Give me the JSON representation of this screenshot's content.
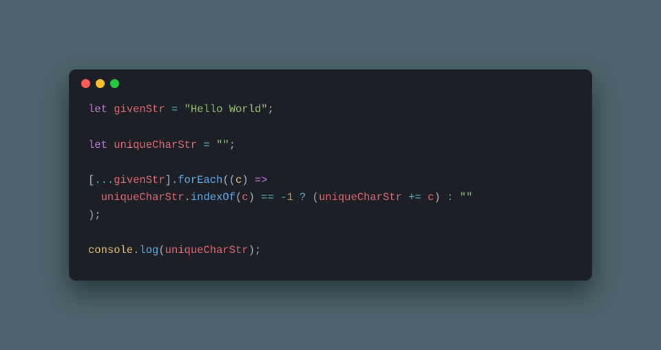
{
  "window": {
    "traffic": {
      "close": "close",
      "minimize": "minimize",
      "zoom": "zoom"
    }
  },
  "code": {
    "line1": {
      "kw": "let",
      "var": "givenStr",
      "assign": "=",
      "str": "\"Hello World\"",
      "semi": ";"
    },
    "line3": {
      "kw": "let",
      "var": "uniqueCharStr",
      "assign": "=",
      "str": "\"\"",
      "semi": ";"
    },
    "line5": {
      "open": "[",
      "spread": "...",
      "var": "givenStr",
      "close_dot": "].",
      "method": "forEach",
      "call_open": "((",
      "param": "c",
      "call_close": ")",
      "arrow": " =>"
    },
    "line6": {
      "indent": "  ",
      "var1": "uniqueCharStr",
      "dot": ".",
      "method": "indexOf",
      "open": "(",
      "param": "c",
      "close": ")",
      "eq": " == ",
      "neg": "-",
      "num": "1",
      "tern_q": " ? ",
      "popen": "(",
      "var2": "uniqueCharStr",
      "pluseq": " += ",
      "param2": "c",
      "pclose": ")",
      "tern_c": " : ",
      "empty": "\"\""
    },
    "line7": {
      "close": ");"
    },
    "line9": {
      "obj": "console",
      "dot": ".",
      "method": "log",
      "open": "(",
      "var": "uniqueCharStr",
      "close": ");"
    }
  }
}
